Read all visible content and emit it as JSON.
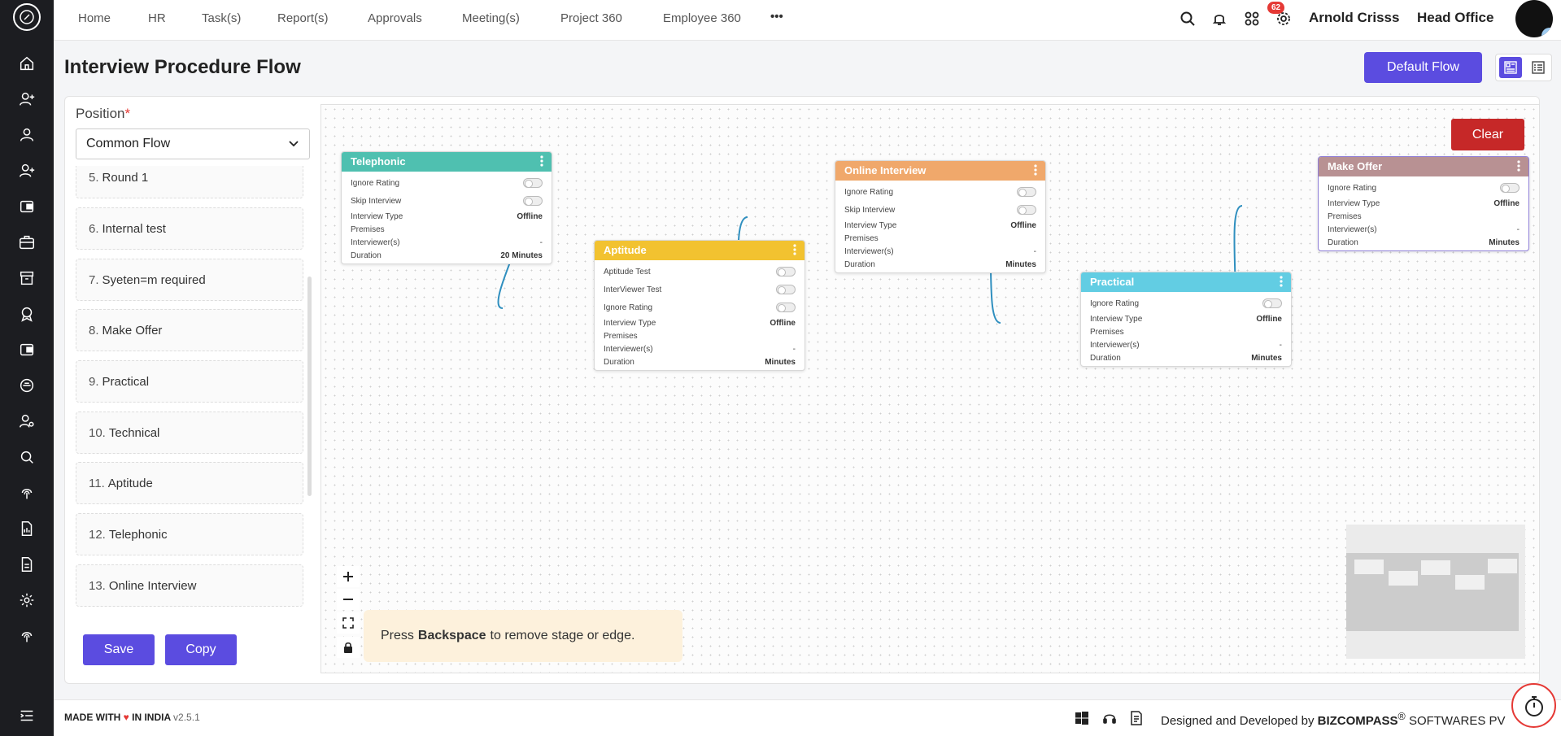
{
  "nav": {
    "items": [
      "Home",
      "HR",
      "Task(s)",
      "Report(s)",
      "Approvals",
      "Meeting(s)",
      "Project 360",
      "Employee 360"
    ],
    "more_label": "•••"
  },
  "topbar": {
    "notification_count": "62",
    "user_name": "Arnold Crisss",
    "office": "Head Office"
  },
  "page": {
    "title": "Interview Procedure Flow",
    "default_flow_label": "Default Flow"
  },
  "position": {
    "label": "Position",
    "required_mark": "*",
    "selected": "Common Flow"
  },
  "stages": [
    {
      "num": "5.",
      "name": "Round 1"
    },
    {
      "num": "6.",
      "name": "Internal test"
    },
    {
      "num": "7.",
      "name": "Syeten=m required"
    },
    {
      "num": "8.",
      "name": "Make Offer"
    },
    {
      "num": "9.",
      "name": "Practical"
    },
    {
      "num": "10.",
      "name": "Technical"
    },
    {
      "num": "11.",
      "name": "Aptitude"
    },
    {
      "num": "12.",
      "name": "Telephonic"
    },
    {
      "num": "13.",
      "name": "Online Interview"
    }
  ],
  "actions": {
    "save_label": "Save",
    "copy_label": "Copy",
    "clear_label": "Clear"
  },
  "nodes": {
    "telephonic": {
      "title": "Telephonic",
      "color": "#4fc0b0",
      "ignore_rating": "Ignore Rating",
      "skip_interview": "Skip Interview",
      "interview_type_label": "Interview Type",
      "interview_type": "Offline",
      "premises": "Premises",
      "interviewers_label": "Interviewer(s)",
      "interviewers": "-",
      "duration_label": "Duration",
      "duration": "20 Minutes"
    },
    "aptitude": {
      "title": "Aptitude",
      "color": "#f2c230",
      "aptitude_test": "Aptitude Test",
      "interviewer_test": "InterViewer Test",
      "ignore_rating": "Ignore Rating",
      "interview_type_label": "Interview Type",
      "interview_type": "Offline",
      "premises": "Premises",
      "interviewers_label": "Interviewer(s)",
      "interviewers": "-",
      "duration_label": "Duration",
      "duration": "Minutes"
    },
    "online": {
      "title": "Online Interview",
      "color": "#f0a86b",
      "ignore_rating": "Ignore Rating",
      "skip_interview": "Skip Interview",
      "interview_type_label": "Interview Type",
      "interview_type": "Offline",
      "premises": "Premises",
      "interviewers_label": "Interviewer(s)",
      "interviewers": "-",
      "duration_label": "Duration",
      "duration": "Minutes"
    },
    "practical": {
      "title": "Practical",
      "color": "#62cde3",
      "ignore_rating": "Ignore Rating",
      "interview_type_label": "Interview Type",
      "interview_type": "Offline",
      "premises": "Premises",
      "interviewers_label": "Interviewer(s)",
      "interviewers": "-",
      "duration_label": "Duration",
      "duration": "Minutes"
    },
    "make_offer": {
      "title": "Make Offer",
      "color": "#b89193",
      "ignore_rating": "Ignore Rating",
      "interview_type_label": "Interview Type",
      "interview_type": "Offline",
      "premises": "Premises",
      "interviewers_label": "Interviewer(s)",
      "interviewers": "-",
      "duration_label": "Duration",
      "duration": "Minutes"
    }
  },
  "canvas": {
    "hint_before": "Press",
    "hint_key": "Backspace",
    "hint_after": "to remove stage or edge."
  },
  "footer": {
    "made_with": "MADE WITH",
    "in_india": "IN INDIA",
    "version": "v2.5.1",
    "designed_by": "Designed and Developed by",
    "company": "BIZCOMPASS",
    "company_mark": "®",
    "company_suffix": "SOFTWARES PV"
  },
  "colors": {
    "primary": "#5b4ce0",
    "danger": "#c62828",
    "edge": "#2f8fbf"
  }
}
